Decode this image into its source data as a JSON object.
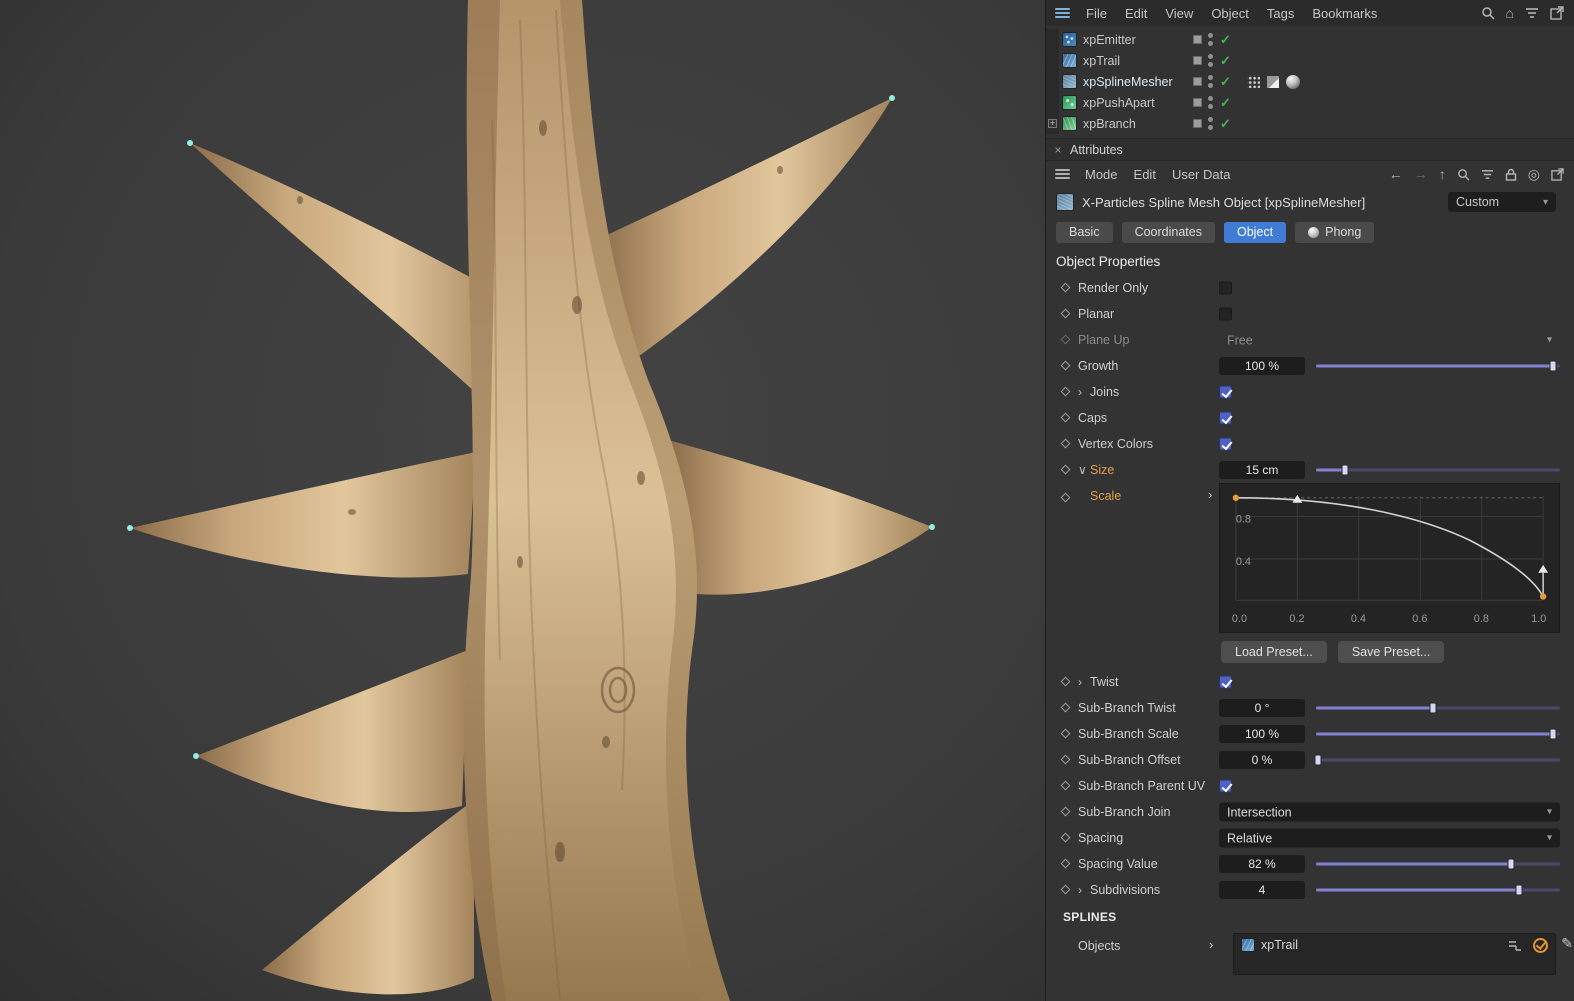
{
  "icons": {
    "close": "×",
    "check": "✓",
    "chevron_right": "›",
    "chevron_down": "∨",
    "caret_down": "▾",
    "home": "⌂",
    "target": "◎",
    "back": "←",
    "forward": "→",
    "up": "↑",
    "pencil": "✎",
    "plus": "+"
  },
  "menubar": {
    "items": [
      "File",
      "Edit",
      "View",
      "Object",
      "Tags",
      "Bookmarks"
    ]
  },
  "object_manager": {
    "objects": [
      {
        "name": "xpEmitter",
        "enabled": true
      },
      {
        "name": "xpTrail",
        "enabled": true
      },
      {
        "name": "xpSplineMesher",
        "enabled": true,
        "selected": true
      },
      {
        "name": "xpPushApart",
        "enabled": true
      },
      {
        "name": "xpBranch",
        "enabled": true
      }
    ]
  },
  "attributes": {
    "title": "Attributes",
    "menu": [
      "Mode",
      "Edit",
      "User Data"
    ],
    "object_header": "X-Particles Spline Mesh Object [xpSplineMesher]",
    "preset": "Custom",
    "tabs": [
      "Basic",
      "Coordinates",
      "Object",
      "Phong"
    ],
    "active_tab": "Object",
    "section": "Object Properties",
    "props": {
      "render_only": {
        "label": "Render Only",
        "checked": false
      },
      "planar": {
        "label": "Planar",
        "checked": false
      },
      "plane_up": {
        "label": "Plane Up",
        "value": "Free",
        "disabled": true
      },
      "growth": {
        "label": "Growth",
        "value": "100 %"
      },
      "joins": {
        "label": "Joins",
        "checked": true
      },
      "caps": {
        "label": "Caps",
        "checked": true
      },
      "vertex_colors": {
        "label": "Vertex Colors",
        "checked": true
      },
      "size": {
        "label": "Size",
        "value": "15 cm"
      },
      "scale": {
        "label": "Scale"
      },
      "twist": {
        "label": "Twist",
        "checked": true
      },
      "sub_branch_twist": {
        "label": "Sub-Branch Twist",
        "value": "0 °"
      },
      "sub_branch_scale": {
        "label": "Sub-Branch Scale",
        "value": "100 %"
      },
      "sub_branch_offset": {
        "label": "Sub-Branch Offset",
        "value": "0 %"
      },
      "sub_branch_parent_uv": {
        "label": "Sub-Branch Parent UV",
        "checked": true
      },
      "sub_branch_join": {
        "label": "Sub-Branch Join",
        "value": "Intersection"
      },
      "spacing": {
        "label": "Spacing",
        "value": "Relative"
      },
      "spacing_value": {
        "label": "Spacing Value",
        "value": "82 %"
      },
      "subdivisions": {
        "label": "Subdivisions",
        "value": "4"
      }
    },
    "scale_graph": {
      "y_ticks": [
        "0.8",
        "0.4"
      ],
      "x_ticks": [
        "0.0",
        "0.2",
        "0.4",
        "0.6",
        "0.8",
        "1.0"
      ],
      "curve_points": [
        [
          0.0,
          1.0
        ],
        [
          0.2,
          0.97
        ],
        [
          0.4,
          0.9
        ],
        [
          0.6,
          0.78
        ],
        [
          0.8,
          0.55
        ],
        [
          1.0,
          0.05
        ]
      ]
    },
    "buttons": {
      "load_preset": "Load Preset...",
      "save_preset": "Save Preset..."
    },
    "splines_section": "SPLINES",
    "objects_field": {
      "label": "Objects",
      "items": [
        {
          "name": "xpTrail"
        }
      ]
    }
  }
}
